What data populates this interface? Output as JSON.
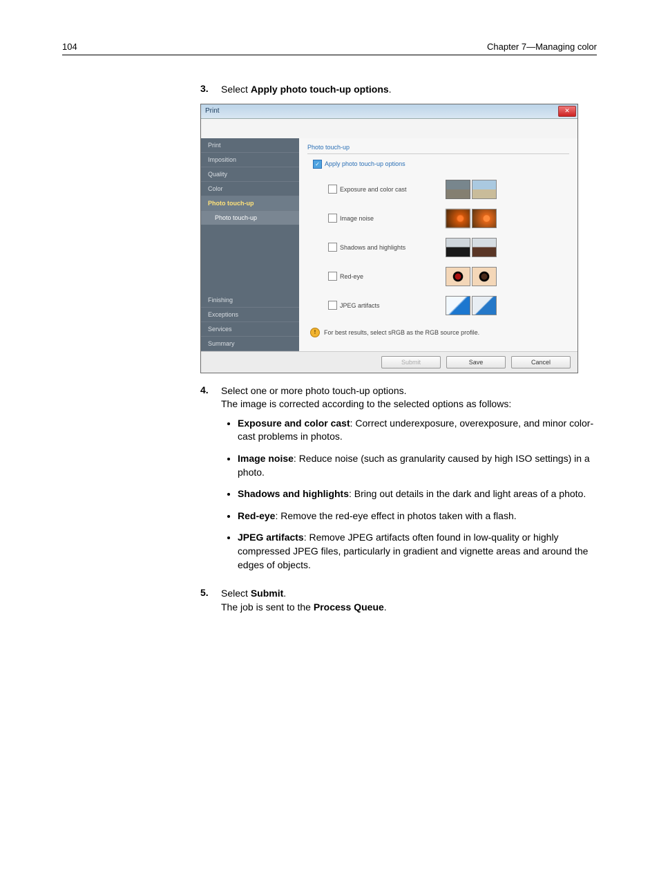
{
  "header": {
    "page_number": "104",
    "chapter": "Chapter 7—Managing color"
  },
  "steps": {
    "s3": {
      "num": "3.",
      "prefix": "Select ",
      "bold": "Apply photo touch-up options",
      "suffix": "."
    },
    "s4": {
      "num": "4.",
      "line1": "Select one or more photo touch-up options.",
      "line2": "The image is corrected according to the selected options as follows:"
    },
    "s5": {
      "num": "5.",
      "prefix": "Select ",
      "bold": "Submit",
      "suffix": ".",
      "line2a": "The job is sent to the ",
      "line2b": "Process Queue",
      "line2c": "."
    }
  },
  "bullets": {
    "b1": {
      "title": "Exposure and color cast",
      "rest": ": Correct underexposure, overexposure, and minor color-cast problems in photos."
    },
    "b2": {
      "title": "Image noise",
      "rest": ": Reduce noise (such as granularity caused by high ISO settings) in a photo."
    },
    "b3": {
      "title": "Shadows and highlights",
      "rest": ": Bring out details in the dark and light areas of a photo."
    },
    "b4": {
      "title": "Red-eye",
      "rest": ": Remove the red-eye effect in photos taken with a flash."
    },
    "b5": {
      "title": "JPEG artifacts",
      "rest": ": Remove JPEG artifacts often found in low-quality or highly compressed JPEG files, particularly in gradient and vignette areas and around the edges of objects."
    }
  },
  "dialog": {
    "title": "Print",
    "close": "✕",
    "sidebar": {
      "print": "Print",
      "imposition": "Imposition",
      "quality": "Quality",
      "color": "Color",
      "touchup": "Photo touch-up",
      "touchup_sub": "Photo touch-up",
      "finishing": "Finishing",
      "exceptions": "Exceptions",
      "services": "Services",
      "summary": "Summary"
    },
    "panel": {
      "section": "Photo touch-up",
      "apply": "Apply photo touch-up options",
      "opt_exposure": "Exposure and color cast",
      "opt_noise": "Image noise",
      "opt_shadows": "Shadows and highlights",
      "opt_redeye": "Red-eye",
      "opt_jpeg": "JPEG artifacts",
      "info": "For best results, select sRGB as the RGB source profile.",
      "info_mark": "!"
    },
    "buttons": {
      "submit": "Submit",
      "save": "Save",
      "cancel": "Cancel"
    }
  },
  "chart_data": {
    "type": "table",
    "title": "Photo touch-up options state",
    "rows": [
      {
        "option": "Apply photo touch-up options",
        "checked": true
      },
      {
        "option": "Exposure and color cast",
        "checked": false
      },
      {
        "option": "Image noise",
        "checked": false
      },
      {
        "option": "Shadows and highlights",
        "checked": false
      },
      {
        "option": "Red-eye",
        "checked": false
      },
      {
        "option": "JPEG artifacts",
        "checked": false
      }
    ]
  }
}
